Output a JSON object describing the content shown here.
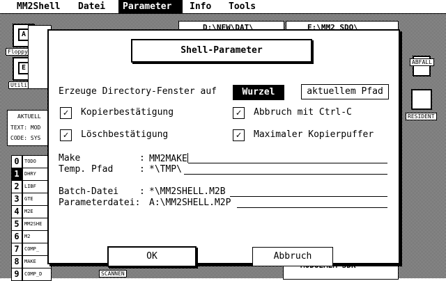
{
  "menubar": {
    "items": [
      {
        "label": "MM2Shell",
        "active": false
      },
      {
        "label": "Datei",
        "active": false
      },
      {
        "label": "Parameter",
        "active": true
      },
      {
        "label": "Info",
        "active": false
      },
      {
        "label": "Tools",
        "active": false
      }
    ]
  },
  "desktop": {
    "floppy_letter": "A",
    "floppy_label": "Floppy DS",
    "utility_letter": "E",
    "utility_label": "Utility",
    "trash_label": "ABFALL",
    "resident_label": "RESIDENT",
    "scannen_label": "SCANNEN"
  },
  "bg_windows": {
    "path1": "D:\\NEW\\DAT\\",
    "path2": "E:\\MM2_SDO\\",
    "aktuell": "AKTUELL",
    "text_line": "TEXT: MOD",
    "code_line": "CODE: SYS",
    "bottom_file": "MODUEMEM SDR"
  },
  "list": {
    "numbers": [
      "0",
      "1",
      "2",
      "3",
      "4",
      "5",
      "6",
      "7",
      "8",
      "9"
    ],
    "selected": "1",
    "entries": [
      "TODO",
      "DHRY",
      "LIBF",
      "GTE",
      "M2E",
      "MM2SHE",
      "M2",
      "COMP_",
      "MAKE",
      "COMP_D"
    ]
  },
  "dialog": {
    "title": "Shell-Parameter",
    "dir_prompt": "Erzeuge Directory-Fenster auf",
    "dir_option_root": "Wurzel",
    "dir_option_current": "aktuellem Pfad",
    "dir_selected": "Wurzel",
    "check_copy_confirm": {
      "label": "Kopierbestätigung",
      "checked": true
    },
    "check_delete_confirm": {
      "label": "Löschbestätigung",
      "checked": true
    },
    "check_abort_ctrlc": {
      "label": "Abbruch mit Ctrl-C",
      "checked": true
    },
    "check_max_buffer": {
      "label": "Maximaler Kopierpuffer",
      "checked": true
    },
    "check_mark": "✓",
    "make_label": "Make",
    "make_value": "MM2MAKE",
    "temp_label": "Temp. Pfad",
    "temp_value": "*\\TMP\\",
    "batch_label": "Batch-Datei",
    "batch_value": "*\\MM2SHELL.M2B",
    "param_label": "Parameterdatei:",
    "param_value": "A:\\MM2SHELL.M2P",
    "colon": ":",
    "ok_label": "OK",
    "cancel_label": "Abbruch"
  }
}
